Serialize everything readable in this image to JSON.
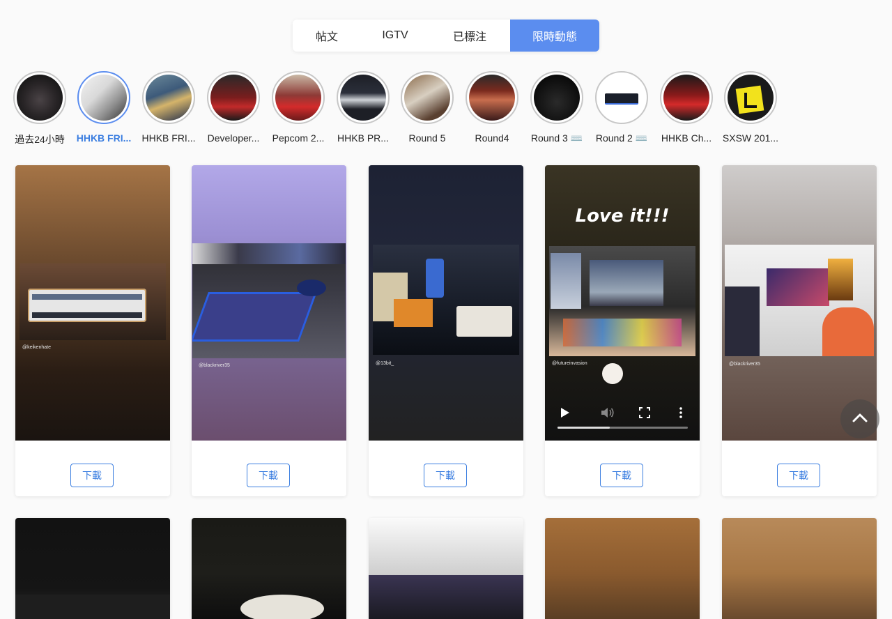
{
  "tabs": [
    {
      "label": "帖文"
    },
    {
      "label": "IGTV"
    },
    {
      "label": "已標注"
    },
    {
      "label": "限時動態"
    }
  ],
  "active_tab": 3,
  "highlights": [
    {
      "label": "過去24小時"
    },
    {
      "label": "HHKB FRI..."
    },
    {
      "label": "HHKB FRI..."
    },
    {
      "label": "Developer..."
    },
    {
      "label": "Pepcom 2..."
    },
    {
      "label": "HHKB PR..."
    },
    {
      "label": "Round 5"
    },
    {
      "label": "Round4"
    },
    {
      "label": "Round 3 ⌨️"
    },
    {
      "label": "Round 2 ⌨️"
    },
    {
      "label": "HHKB Ch..."
    },
    {
      "label": "SXSW 201..."
    }
  ],
  "stories": [
    {
      "credit": "@keikenhate",
      "button": "下載"
    },
    {
      "credit": "@blackriver35",
      "button": "下載"
    },
    {
      "credit": "@13bit_",
      "button": "下載"
    },
    {
      "credit": "@futureinvasion",
      "button": "下載",
      "overlay_text": "Love it!!!"
    },
    {
      "credit": "@blackriver35",
      "button": "下載"
    }
  ],
  "colors": {
    "accent": "#5b8def",
    "link": "#3b7ee0"
  },
  "icons": {
    "scroll_top": "chevron-up-icon"
  }
}
